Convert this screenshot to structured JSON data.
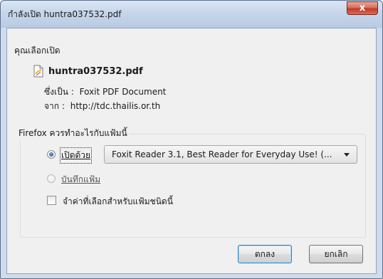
{
  "window": {
    "title": "กำลังเปิด huntra037532.pdf",
    "close_label": "x"
  },
  "dialog": {
    "intro": "คุณเลือกเปิด",
    "filename": "huntra037532.pdf",
    "type_label": "ซึ่งเป็น :",
    "type_value": "Foxit PDF Document",
    "from_label": "จาก :",
    "from_value": "http://tdc.thailis.or.th"
  },
  "action_group": {
    "title": "Firefox ควรทำอะไรกับแฟ้มนี้",
    "open_with_label": "เปิดด้วย",
    "open_with_selected": true,
    "app_dropdown_value": "Foxit Reader 3.1, Best Reader for Everyday Use! (...",
    "save_file_label": "บันทึกแฟ้ม",
    "save_file_selected": false,
    "remember_label": "จำค่าที่เลือกสำหรับแฟ้มชนิดนี้",
    "remember_checked": false
  },
  "buttons": {
    "ok_label": "ตกลง",
    "cancel_label": "ยกเลิก"
  },
  "icons": {
    "file": "pdf-file-icon",
    "close": "close-icon",
    "dropdown": "chevron-down-icon"
  },
  "colors": {
    "titlebar": "#c6d6ea",
    "close_button": "#c0392b",
    "client_bg": "#f0f0f0",
    "default_button_border": "#3c7fb1"
  }
}
